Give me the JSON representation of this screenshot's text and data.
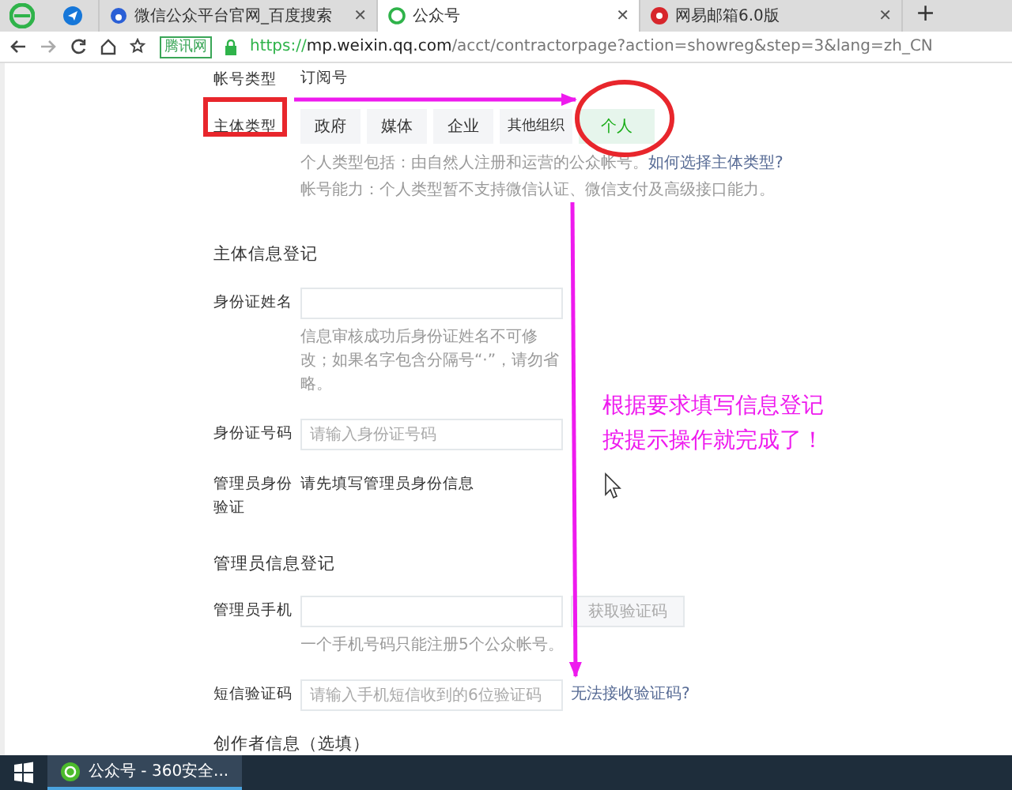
{
  "browser": {
    "tabs": [
      {
        "kind": "pinned",
        "selected": false
      },
      {
        "kind": "search",
        "title": "微信公众平台官网_百度搜索",
        "close": "✕",
        "selected": false
      },
      {
        "kind": "wechat",
        "title": "公众号",
        "close": "✕",
        "selected": true
      },
      {
        "kind": "mail",
        "title": "网易邮箱6.0版",
        "close": "✕",
        "selected": false
      }
    ],
    "new_tab": "+",
    "site_badge": "腾讯网",
    "url_scheme": "https://",
    "url_host": "mp.weixin.qq.com",
    "url_path": "/acct/contractorpage?action=showreg&step=3&lang=zh_CN"
  },
  "form": {
    "account_type": {
      "label": "帐号类型",
      "value": "订阅号"
    },
    "subject_type": {
      "label": "主体类型",
      "options": [
        {
          "label": "政府",
          "selected": false
        },
        {
          "label": "媒体",
          "selected": false
        },
        {
          "label": "企业",
          "selected": false
        },
        {
          "label": "其他组织",
          "selected": false
        },
        {
          "label": "个人",
          "selected": true
        }
      ],
      "hint_1": "个人类型包括：由自然人注册和运营的公众帐号。",
      "hint_link": "如何选择主体类型?",
      "hint_2": "帐号能力：个人类型暂不支持微信认证、微信支付及高级接口能力。"
    },
    "sections": [
      {
        "title": "主体信息登记",
        "fields": [
          {
            "kind": "input",
            "label": "身份证姓名",
            "hint": "信息审核成功后身份证姓名不可修改；如果名字包含分隔号“·”，请勿省略。"
          },
          {
            "kind": "input",
            "label": "身份证号码",
            "placeholder": "请输入身份证号码"
          },
          {
            "kind": "text",
            "label": "管理员身份验证",
            "value": "请先填写管理员身份信息"
          }
        ]
      },
      {
        "title": "管理员信息登记",
        "fields": [
          {
            "kind": "input",
            "label": "管理员手机",
            "button": "获取验证码",
            "hint": "一个手机号码只能注册5个公众帐号。"
          },
          {
            "kind": "input",
            "label": "短信验证码",
            "placeholder": "请输入手机短信收到的6位验证码",
            "link": "无法接收验证码?"
          }
        ]
      },
      {
        "title": "创作者信息（选填）"
      }
    ]
  },
  "annotation": {
    "lines": [
      "根据要求填写信息登记",
      "按提示操作就完成了！"
    ]
  },
  "taskbar": {
    "task": "公众号 - 360安全..."
  }
}
